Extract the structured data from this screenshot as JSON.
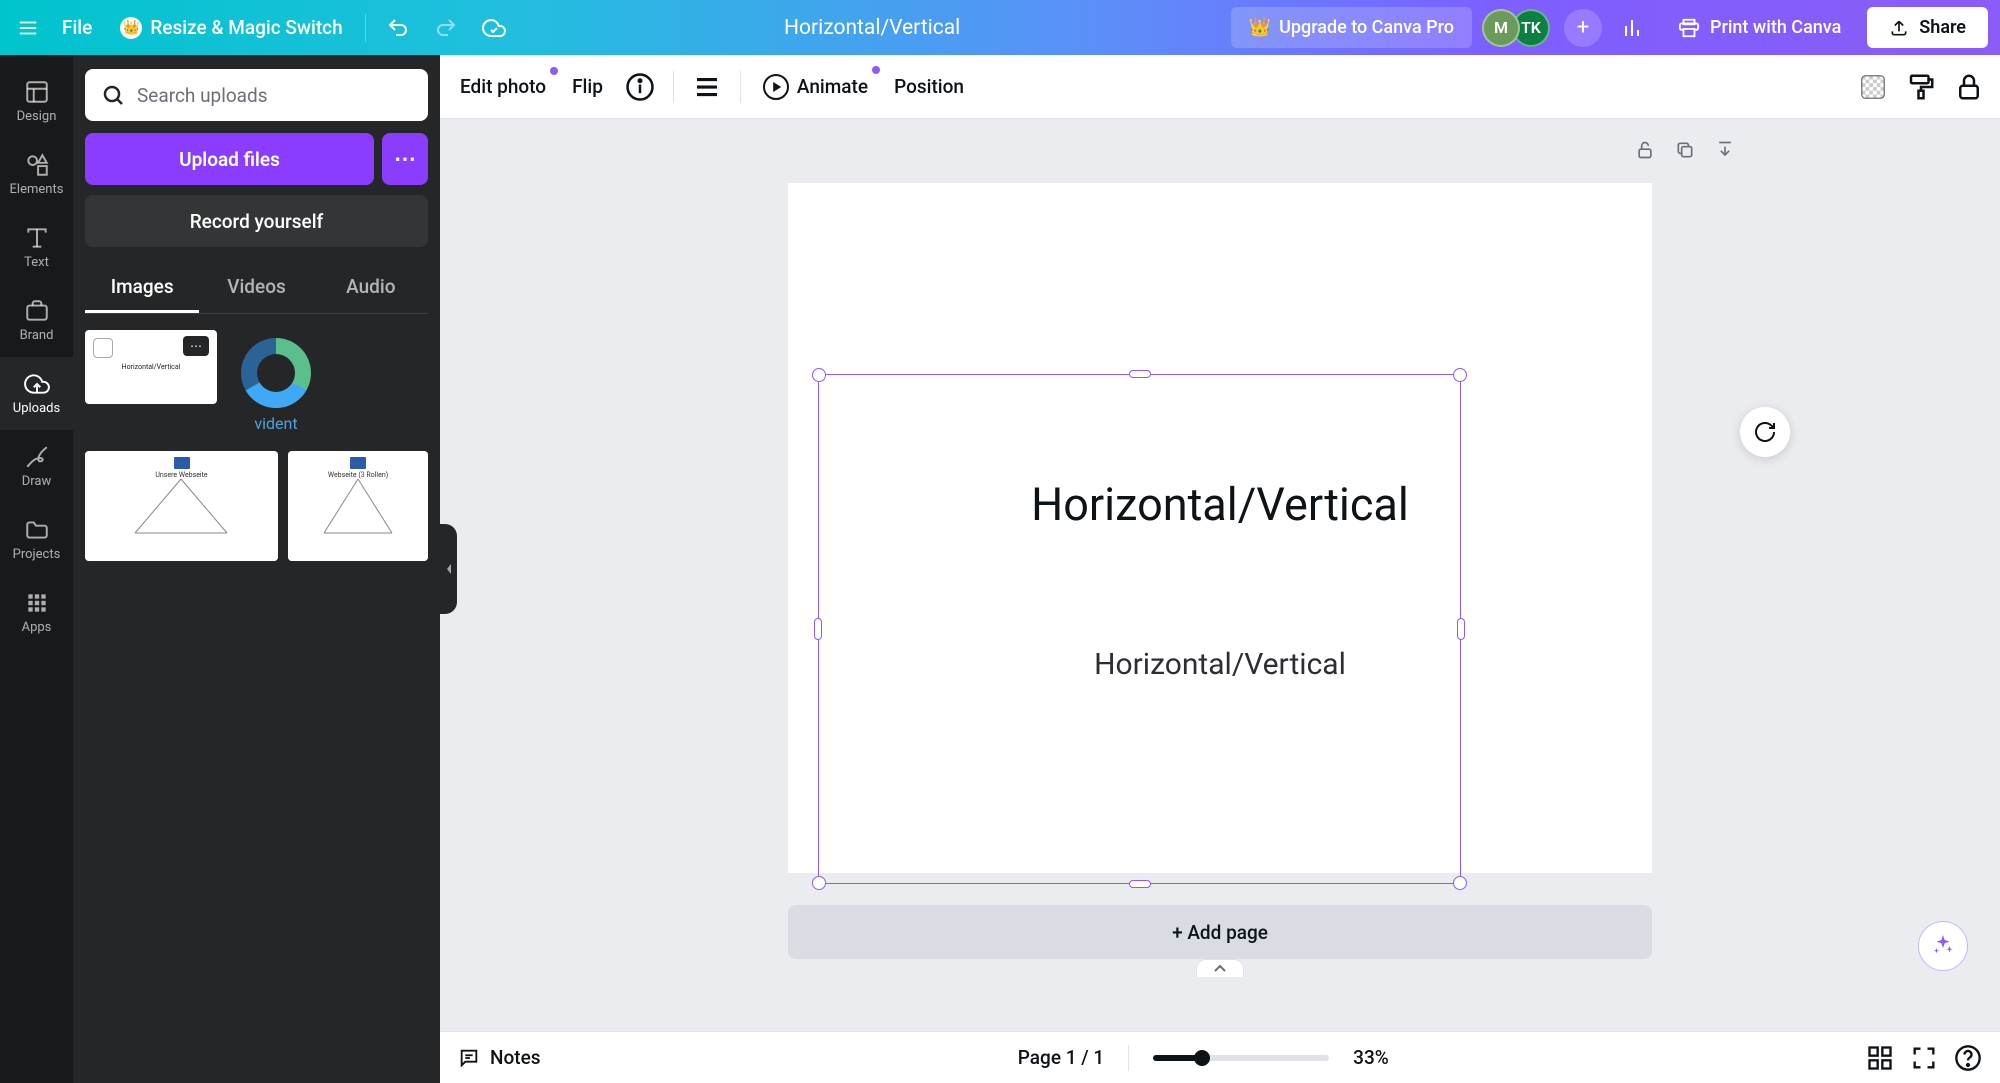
{
  "header": {
    "file_label": "File",
    "resize_label": "Resize & Magic Switch",
    "doc_title": "Horizontal/Vertical",
    "upgrade_label": "Upgrade to Canva Pro",
    "avatar1": "M",
    "avatar2": "TK",
    "print_label": "Print with Canva",
    "share_label": "Share"
  },
  "rail": {
    "items": [
      {
        "label": "Design",
        "icon": "layout"
      },
      {
        "label": "Elements",
        "icon": "shapes"
      },
      {
        "label": "Text",
        "icon": "text"
      },
      {
        "label": "Brand",
        "icon": "brand"
      },
      {
        "label": "Uploads",
        "icon": "cloud-upload"
      },
      {
        "label": "Draw",
        "icon": "draw"
      },
      {
        "label": "Projects",
        "icon": "folder"
      },
      {
        "label": "Apps",
        "icon": "apps"
      }
    ],
    "active_index": 4
  },
  "panel": {
    "search_placeholder": "Search uploads",
    "upload_files_label": "Upload files",
    "record_label": "Record yourself",
    "tabs": [
      "Images",
      "Videos",
      "Audio"
    ],
    "active_tab": 0,
    "thumbs": {
      "thumb1_caption": "Horizontal/Vertical",
      "thumb2_caption": "vident",
      "thumb3_title": "Unsere Webseite",
      "thumb4_title": "Webseite (3 Rollen)"
    }
  },
  "ctx_toolbar": {
    "edit_photo": "Edit photo",
    "flip": "Flip",
    "animate": "Animate",
    "position": "Position"
  },
  "canvas": {
    "main_text": "Horizontal/Vertical",
    "sub_text": "Horizontal/Vertical",
    "add_page": "+ Add page"
  },
  "footer": {
    "notes": "Notes",
    "page": "Page 1 / 1",
    "zoom": "33%"
  },
  "colors": {
    "accent_purple": "#8B3DFF",
    "selection": "#8B5CF6",
    "rail_bg": "#18191B",
    "panel_bg": "#252627"
  }
}
